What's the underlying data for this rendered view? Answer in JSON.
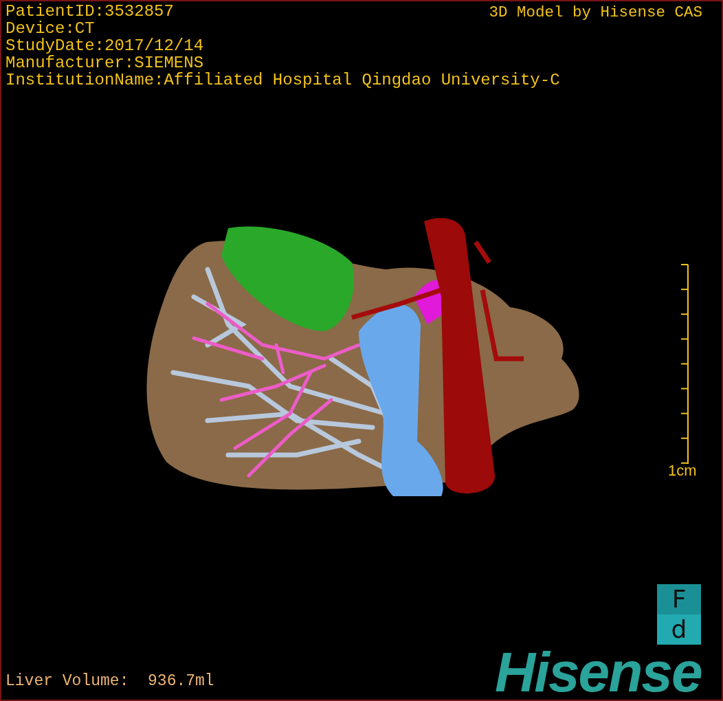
{
  "patient_info": [
    "PatientID:3532857",
    "Device:CT",
    "StudyDate:2017/12/14",
    "Manufacturer:SIEMENS",
    "InstitutionName:Affiliated Hospital Qingdao University-C"
  ],
  "model_credit": "3D Model by Hisense CAS",
  "scale_bar": {
    "label": "1cm"
  },
  "liver_volume": "Liver Volume:  936.7ml",
  "logo": {
    "badge_top": "F",
    "badge_bottom": "d",
    "wordmark": "Hisense"
  }
}
